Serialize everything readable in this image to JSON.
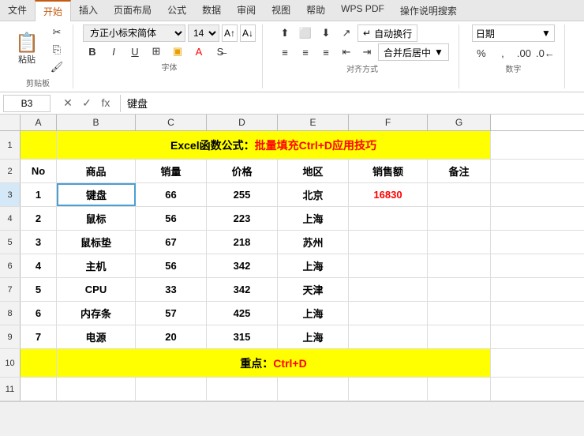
{
  "tabs": [
    "文件",
    "开始",
    "插入",
    "页面布局",
    "公式",
    "数据",
    "审阅",
    "视图",
    "帮助",
    "WPS PDF",
    "操作说明搜索"
  ],
  "activeTab": "开始",
  "font": {
    "name": "方正小标宋简体",
    "size": "14",
    "increaseSizeLabel": "A",
    "decreaseSizeLabel": "A"
  },
  "toolbar": {
    "paste": "粘贴",
    "clipboard_label": "剪贴板",
    "font_label": "字体",
    "align_label": "对齐方式",
    "number_label": "数字",
    "autowrap": "自动换行",
    "merge": "合并后居中",
    "number_format": "日期"
  },
  "formulaBar": {
    "cellRef": "B3",
    "formula": "键盘"
  },
  "columns": [
    "A",
    "B",
    "C",
    "D",
    "E",
    "F",
    "G"
  ],
  "rows": [
    {
      "rowNum": "1",
      "cells": [
        "",
        "Excel函数公式：批量填充Ctrl+D应用技巧",
        "",
        "",
        "",
        "",
        ""
      ],
      "type": "title"
    },
    {
      "rowNum": "2",
      "cells": [
        "No",
        "商品",
        "销量",
        "价格",
        "地区",
        "销售额",
        "备注"
      ],
      "type": "header"
    },
    {
      "rowNum": "3",
      "cells": [
        "1",
        "键盘",
        "66",
        "255",
        "北京",
        "16830",
        ""
      ],
      "type": "data",
      "selected": true
    },
    {
      "rowNum": "4",
      "cells": [
        "2",
        "鼠标",
        "56",
        "223",
        "上海",
        "",
        ""
      ],
      "type": "data"
    },
    {
      "rowNum": "5",
      "cells": [
        "3",
        "鼠标垫",
        "67",
        "218",
        "苏州",
        "",
        ""
      ],
      "type": "data"
    },
    {
      "rowNum": "6",
      "cells": [
        "4",
        "主机",
        "56",
        "342",
        "上海",
        "",
        ""
      ],
      "type": "data"
    },
    {
      "rowNum": "7",
      "cells": [
        "5",
        "CPU",
        "33",
        "342",
        "天津",
        "",
        ""
      ],
      "type": "data"
    },
    {
      "rowNum": "8",
      "cells": [
        "6",
        "内存条",
        "57",
        "425",
        "上海",
        "",
        ""
      ],
      "type": "data"
    },
    {
      "rowNum": "9",
      "cells": [
        "7",
        "电源",
        "20",
        "315",
        "上海",
        "",
        ""
      ],
      "type": "data"
    },
    {
      "rowNum": "10",
      "cells": [
        "",
        "重点：Ctrl+D",
        "",
        "",
        "",
        "",
        ""
      ],
      "type": "note"
    },
    {
      "rowNum": "11",
      "cells": [
        "",
        "",
        "",
        "",
        "",
        "",
        ""
      ],
      "type": "empty"
    }
  ]
}
